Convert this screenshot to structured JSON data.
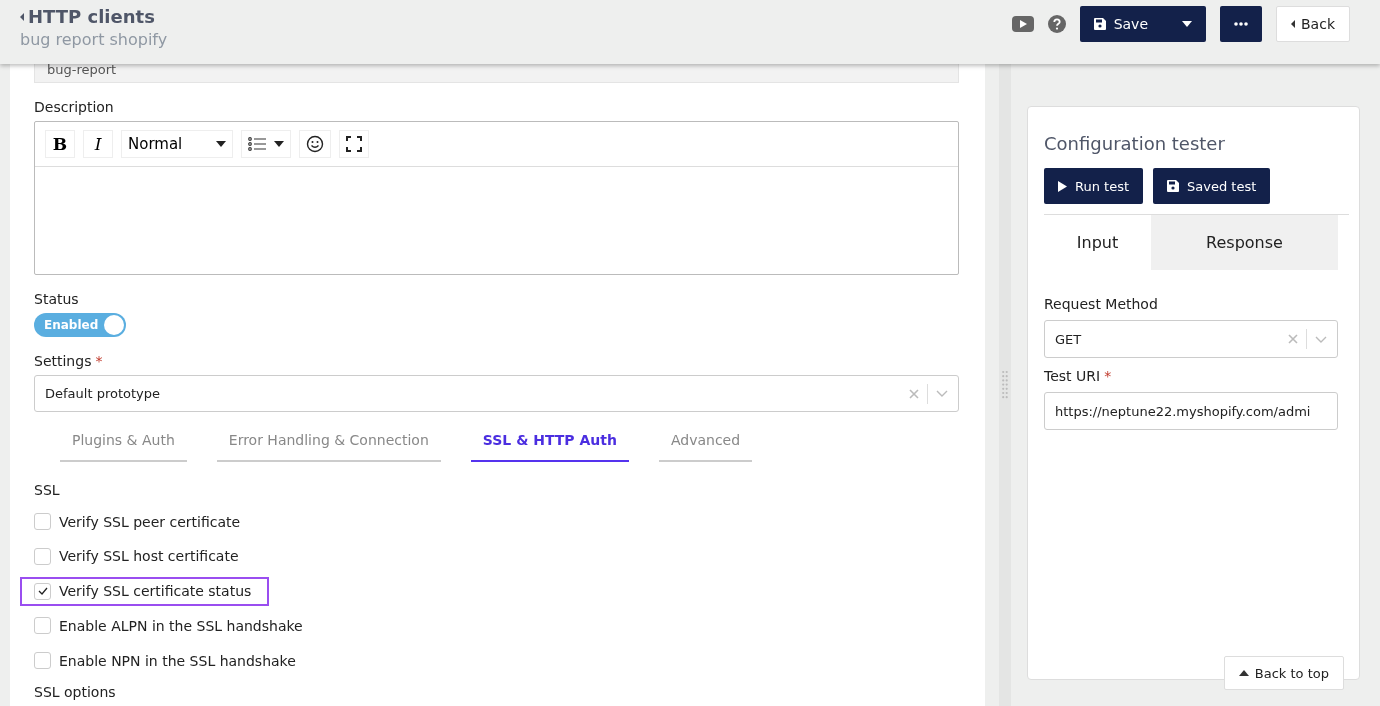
{
  "header": {
    "title": "HTTP clients",
    "subtitle": "bug report shopify",
    "buttons": [
      {
        "kind": "video"
      },
      {
        "kind": "help"
      },
      {
        "kind": "save",
        "label": "Save"
      },
      {
        "kind": "more"
      },
      {
        "kind": "back",
        "label": "Back"
      }
    ]
  },
  "name_field": {
    "value": "bug-report"
  },
  "description": {
    "label": "Description",
    "toolbar": [
      {
        "kind": "bold",
        "label": "B"
      },
      {
        "kind": "italic",
        "label": "I"
      },
      {
        "kind": "select",
        "label": "Normal"
      },
      {
        "kind": "list"
      },
      {
        "kind": "emoji"
      },
      {
        "kind": "fullscreen"
      }
    ]
  },
  "status": {
    "label": "Status",
    "toggle": {
      "label": "Enabled",
      "on": true
    }
  },
  "settings": {
    "label": "Settings",
    "required_mark": "*",
    "value": "Default prototype"
  },
  "tabs": [
    {
      "label": "Plugins & Auth",
      "selected": false
    },
    {
      "label": "Error Handling & Connection",
      "selected": false
    },
    {
      "label": "SSL & HTTP Auth",
      "selected": true
    },
    {
      "label": "Advanced",
      "selected": false
    }
  ],
  "ssl": {
    "heading": "SSL",
    "options": [
      {
        "label": "Verify SSL peer certificate",
        "checked": false,
        "highlighted": false
      },
      {
        "label": "Verify SSL host certificate",
        "checked": false,
        "highlighted": false
      },
      {
        "label": "Verify SSL certificate status",
        "checked": true,
        "highlighted": true
      },
      {
        "label": "Enable ALPN in the SSL handshake",
        "checked": false,
        "highlighted": false
      },
      {
        "label": "Enable NPN in the SSL handshake",
        "checked": false,
        "highlighted": false
      }
    ],
    "options_heading": "SSL options"
  },
  "tester": {
    "title": "Configuration tester",
    "buttons": [
      {
        "kind": "run",
        "label": "Run test"
      },
      {
        "kind": "save",
        "label": "Saved test"
      }
    ],
    "tabs": [
      {
        "label": "Input",
        "selected": true
      },
      {
        "label": "Response",
        "selected": false
      }
    ],
    "method": {
      "label": "Request Method",
      "value": "GET"
    },
    "uri": {
      "label": "Test URI",
      "required_mark": "*",
      "value": "https://neptune22.myshopify.com/admi"
    }
  },
  "back_to_top": {
    "label": "Back to top"
  }
}
